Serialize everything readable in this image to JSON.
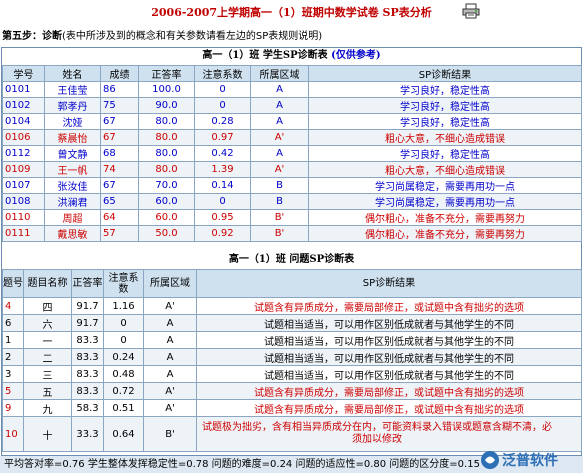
{
  "header": {
    "title": "2006-2007上学期高一（1）班期中数学试卷 SP表分析",
    "print_icon": "printer-icon"
  },
  "step": {
    "label": "第五步：诊断",
    "note": "(表中所涉及到的概念和有关参数请看左边的SP表规则说明)"
  },
  "student_table": {
    "title": "高一（1）班 学生SP诊断表",
    "title_note": "(仅供参考)",
    "columns": [
      "学号",
      "姓名",
      "成绩",
      "正答率",
      "注意系数",
      "所属区域",
      "SP诊断结果"
    ],
    "rows": [
      {
        "id": "0101",
        "name": "王佳莹",
        "score": "86",
        "rate": "100.0",
        "coef": "0",
        "zone": "A",
        "result": "学习良好，稳定性高",
        "type": "good"
      },
      {
        "id": "0102",
        "name": "郭孝丹",
        "score": "75",
        "rate": "90.0",
        "coef": "0",
        "zone": "A",
        "result": "学习良好，稳定性高",
        "type": "good"
      },
      {
        "id": "0104",
        "name": "沈娅",
        "score": "67",
        "rate": "80.0",
        "coef": "0.28",
        "zone": "A",
        "result": "学习良好，稳定性高",
        "type": "good"
      },
      {
        "id": "0106",
        "name": "蔡晨怡",
        "score": "67",
        "rate": "80.0",
        "coef": "0.97",
        "zone": "A'",
        "result": "粗心大意，不细心造成错误",
        "type": "bad"
      },
      {
        "id": "0112",
        "name": "曾文静",
        "score": "68",
        "rate": "80.0",
        "coef": "0.42",
        "zone": "A",
        "result": "学习良好，稳定性高",
        "type": "good"
      },
      {
        "id": "0109",
        "name": "王一帆",
        "score": "74",
        "rate": "80.0",
        "coef": "1.39",
        "zone": "A'",
        "result": "粗心大意，不细心造成错误",
        "type": "bad"
      },
      {
        "id": "0107",
        "name": "张汝佳",
        "score": "67",
        "rate": "70.0",
        "coef": "0.14",
        "zone": "B",
        "result": "学习尚属稳定，需要再用功一点",
        "type": "good"
      },
      {
        "id": "0108",
        "name": "洪澜君",
        "score": "65",
        "rate": "60.0",
        "coef": "0",
        "zone": "B",
        "result": "学习尚属稳定，需要再用功一点",
        "type": "good"
      },
      {
        "id": "0110",
        "name": "周超",
        "score": "64",
        "rate": "60.0",
        "coef": "0.95",
        "zone": "B'",
        "result": "偶尔粗心，准备不充分，需要再努力",
        "type": "bad"
      },
      {
        "id": "0111",
        "name": "戴思敏",
        "score": "57",
        "rate": "50.0",
        "coef": "0.92",
        "zone": "B'",
        "result": "偶尔粗心，准备不充分，需要再努力",
        "type": "bad"
      }
    ]
  },
  "question_table": {
    "title": "高一（1）班 问题SP诊断表",
    "columns": [
      "题号",
      "题目名称",
      "正答率",
      "注意系数",
      "所属区域",
      "SP诊断结果"
    ],
    "rows": [
      {
        "no": "4",
        "name": "四",
        "rate": "91.7",
        "coef": "1.16",
        "zone": "A'",
        "result": "试题含有异质成分，需要局部修正，或试题中含有拙劣的选项",
        "type": "bad"
      },
      {
        "no": "6",
        "name": "六",
        "rate": "91.7",
        "coef": "0",
        "zone": "A",
        "result": "试题相当适当，可以用作区别低成就者与其他学生的不同",
        "type": "good"
      },
      {
        "no": "1",
        "name": "一",
        "rate": "83.3",
        "coef": "0",
        "zone": "A",
        "result": "试题相当适当，可以用作区别低成就者与其他学生的不同",
        "type": "good"
      },
      {
        "no": "2",
        "name": "二",
        "rate": "83.3",
        "coef": "0.24",
        "zone": "A",
        "result": "试题相当适当，可以用作区别低成就者与其他学生的不同",
        "type": "good"
      },
      {
        "no": "3",
        "name": "三",
        "rate": "83.3",
        "coef": "0.48",
        "zone": "A",
        "result": "试题相当适当，可以用作区别低成就者与其他学生的不同",
        "type": "good"
      },
      {
        "no": "5",
        "name": "五",
        "rate": "83.3",
        "coef": "0.72",
        "zone": "A'",
        "result": "试题含有异质成分，需要局部修正，或试题中含有拙劣的选项",
        "type": "bad"
      },
      {
        "no": "9",
        "name": "九",
        "rate": "58.3",
        "coef": "0.51",
        "zone": "A'",
        "result": "试题含有异质成分，需要局部修正，或试题中含有拙劣的选项",
        "type": "bad"
      },
      {
        "no": "10",
        "name": "十",
        "rate": "33.3",
        "coef": "0.64",
        "zone": "B'",
        "result": "试题极为拙劣，含有相当异质成分在内，可能资料录入错误或题意含糊不清，必须加以修改",
        "type": "bad"
      }
    ]
  },
  "footer": {
    "text": "平均答对率=0.76  学生整体发挥稳定性=0.78  问题的难度=0.24  问题的适应性=0.80  问题的区分度=0.15"
  },
  "logo": {
    "text": "泛普软件",
    "icon": "fanpu-logo-icon"
  }
}
